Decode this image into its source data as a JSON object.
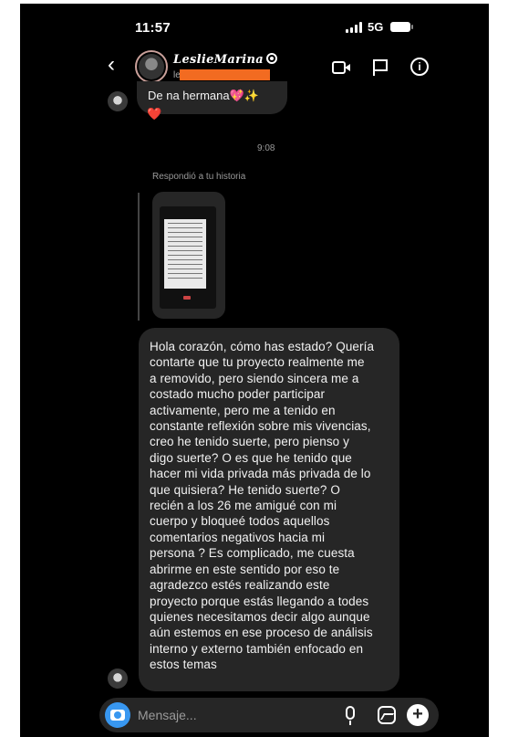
{
  "status_bar": {
    "time": "11:57",
    "network": "5G"
  },
  "header": {
    "back_icon": "chevron-left-icon",
    "contact_name": "LeslieMarina",
    "contact_subtitle_prefix": "le",
    "redaction_color": "#f26b21",
    "actions": [
      "video-call-icon",
      "flag-icon",
      "info-icon"
    ]
  },
  "messages": [
    {
      "from": "contact",
      "text": "De na hermana💖✨",
      "reaction": "❤️"
    }
  ],
  "timestamp": "9:08",
  "story_reply": {
    "label": "Respondió a tu historia"
  },
  "main_message": {
    "lines": [
      "Hola corazón, cómo has estado? Quería",
      "contarte que tu proyecto realmente me",
      "a removido, pero siendo sincera me a",
      "costado mucho poder participar",
      "activamente, pero me a tenido en",
      "constante reflexión sobre mis vivencias,",
      "creo he tenido suerte, pero pienso y",
      "digo suerte? O es que he tenido que",
      "hacer mi vida privada más privada de lo",
      "que quisiera? He tenido suerte? O",
      "recién a los 26 me amigué con mi",
      "cuerpo y bloqueé todos aquellos",
      "comentarios negativos hacia mi",
      "persona ? Es complicado, me cuesta",
      "abrirme en este sentido por eso te",
      "agradezco estés realizando este",
      "proyecto porque estás llegando a todes",
      "quienes necesitamos decir algo aunque",
      "aún estemos en ese proceso de análisis",
      "interno y externo también enfocado en",
      "estos temas"
    ]
  },
  "composer": {
    "placeholder": "Mensaje...",
    "camera_color": "#3897f0"
  }
}
